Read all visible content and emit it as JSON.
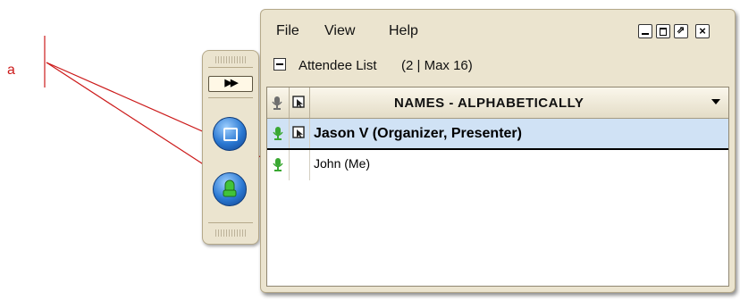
{
  "annotation": {
    "label": "a"
  },
  "control_panel": {
    "expand_label": "▶▶"
  },
  "window": {
    "menu": {
      "file": "File",
      "view": "View",
      "help": "Help"
    },
    "controls": {
      "close": "×",
      "popout": "⇗"
    }
  },
  "attendee_panel": {
    "title": "Attendee List",
    "count": "(2 | Max 16)",
    "header": "NAMES - ALPHABETICALLY",
    "attendees": [
      {
        "name": "Jason V (Organizer, Presenter)",
        "selected": true
      },
      {
        "name": "John (Me)",
        "selected": false
      }
    ]
  },
  "colors": {
    "annotation": "#cc1a1a",
    "selection": "#d0e2f5",
    "mic_green": "#3aa832",
    "button_blue": "#2a78d2"
  },
  "icons": [
    "microphone-icon",
    "presenter-icon",
    "sort-arrow-icon",
    "expand-icon",
    "share-screen-icon",
    "mic-button-icon"
  ]
}
